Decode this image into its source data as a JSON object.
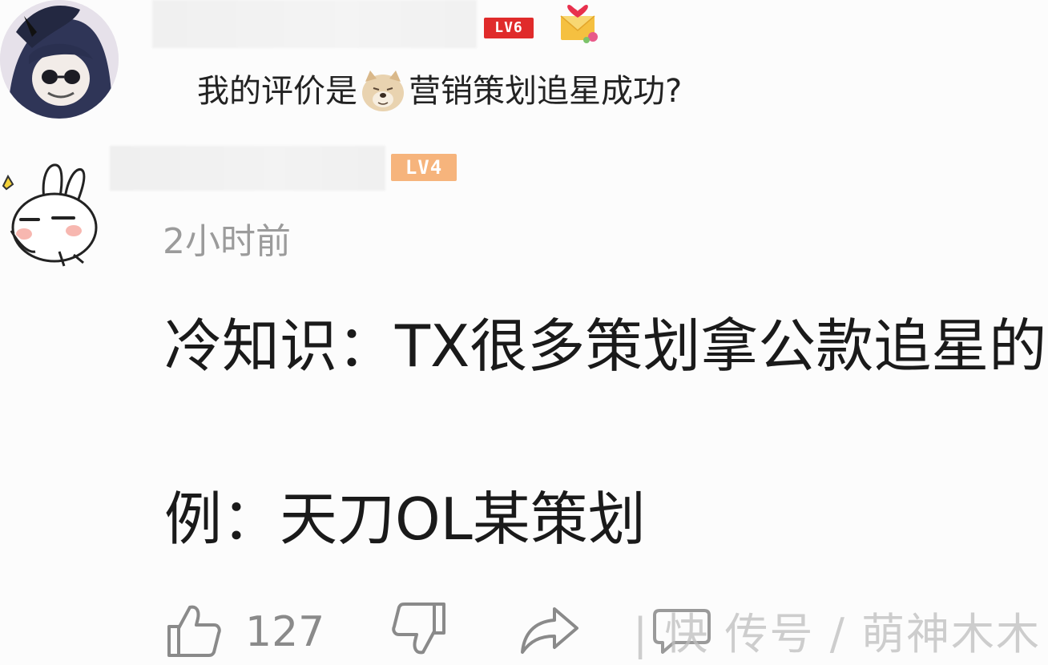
{
  "comments": [
    {
      "level": "LV6",
      "text_before": "我的评价是",
      "emoji": "doge-icon",
      "text_after": "营销策划追星成功?"
    },
    {
      "level": "LV4",
      "time": "2小时前",
      "line1": "冷知识：TX很多策划拿公款追星的",
      "line2": "例：天刀OL某策划",
      "likes": "127"
    }
  ],
  "watermark": "| 快 传号 / 萌神木木",
  "colors": {
    "level6_badge": "#e02b2b",
    "level4_badge": "#f6b47c",
    "timestamp": "#9b9b9b",
    "text": "#1a1a1a",
    "icon_gray": "#8a8a8a"
  }
}
